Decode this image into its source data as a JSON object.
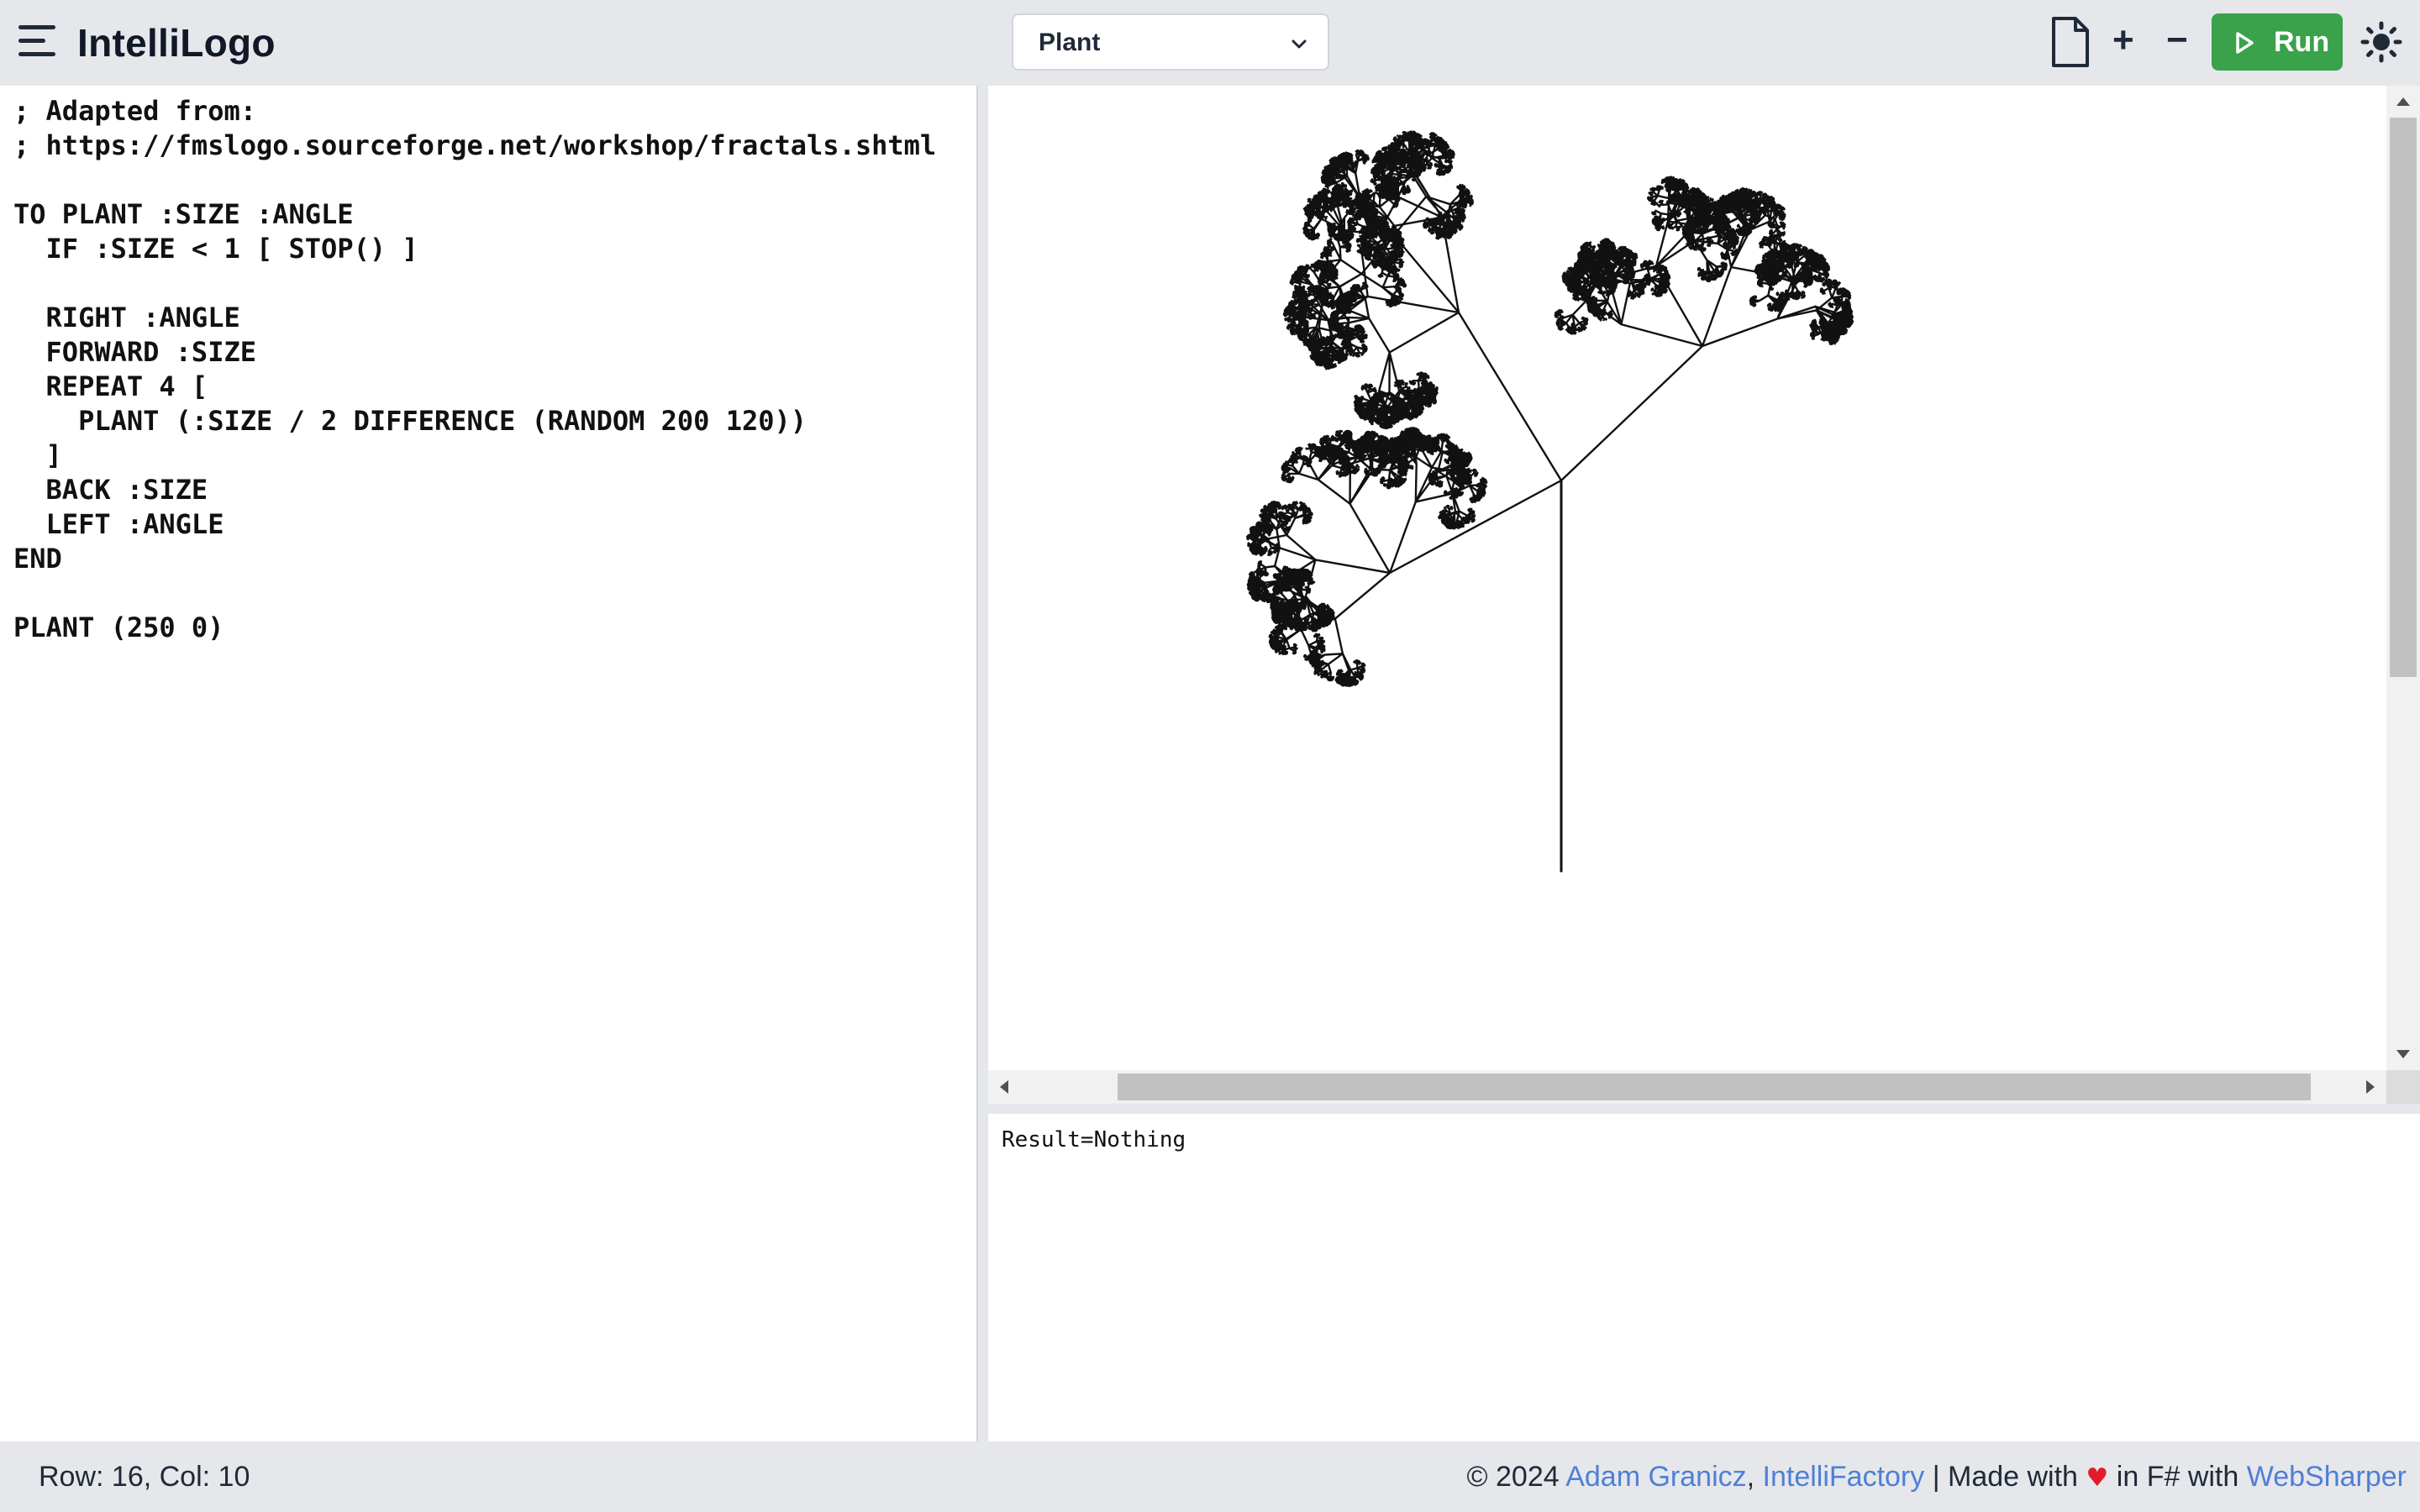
{
  "header": {
    "title": "IntelliLogo",
    "example_selected": "Plant"
  },
  "toolbar": {
    "new_file_icon": "new-file-icon",
    "zoom_in_label": "+",
    "zoom_out_label": "−",
    "run_label": "Run",
    "theme_icon": "sun-icon"
  },
  "editor": {
    "code": "; Adapted from:\n; https://fmslogo.sourceforge.net/workshop/fractals.shtml\n\nTO PLANT :SIZE :ANGLE\n  IF :SIZE < 1 [ STOP() ]\n\n  RIGHT :ANGLE\n  FORWARD :SIZE\n  REPEAT 4 [\n    PLANT (:SIZE / 2 DIFFERENCE (RANDOM 200 120))\n  ]\n  BACK :SIZE\n  LEFT :ANGLE\nEND\n\nPLANT (250 0)"
  },
  "output": {
    "text": "Result=Nothing"
  },
  "footer": {
    "cursor_position": "Row: 16, Col: 10",
    "copyright": "© 2024",
    "author_link": "Adam Granicz",
    "separator": ",",
    "company_link": "IntelliFactory",
    "made_with": "| Made with",
    "heart": "♥",
    "in_fsharp": "in F# with",
    "framework_link": "WebSharper"
  },
  "colors": {
    "run_button": "#3aa24a",
    "link": "#4f7fd6",
    "heart": "#e11d2b",
    "chrome_background": "#e5e7eb"
  }
}
